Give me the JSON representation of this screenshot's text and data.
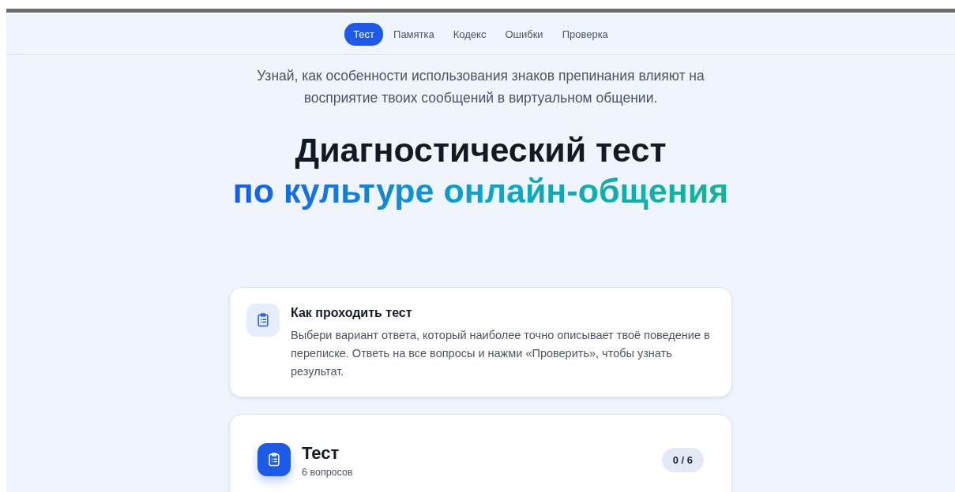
{
  "nav": {
    "tabs": [
      {
        "label": "Тест",
        "selected": true
      },
      {
        "label": "Памятка",
        "selected": false
      },
      {
        "label": "Кодекс",
        "selected": false
      },
      {
        "label": "Ошибки",
        "selected": false
      },
      {
        "label": "Проверка",
        "selected": false
      }
    ]
  },
  "intro": "Узнай, как особенности использования знаков препинания влияют на восприятие твоих сообщений в виртуальном общении.",
  "heading": {
    "line_1": "Диагностический тест",
    "line_2": "по культуре онлайн-общения"
  },
  "instructions": {
    "title": "Как проходить тест",
    "text": "Выбери вариант ответа, который наиболее точно описывает твоё поведение в переписке. Ответь на все вопросы и нажми «Проверить», чтобы узнать результат."
  },
  "test": {
    "title": "Тест",
    "subtitle": "6 вопросов",
    "progress": "0 / 6"
  }
}
